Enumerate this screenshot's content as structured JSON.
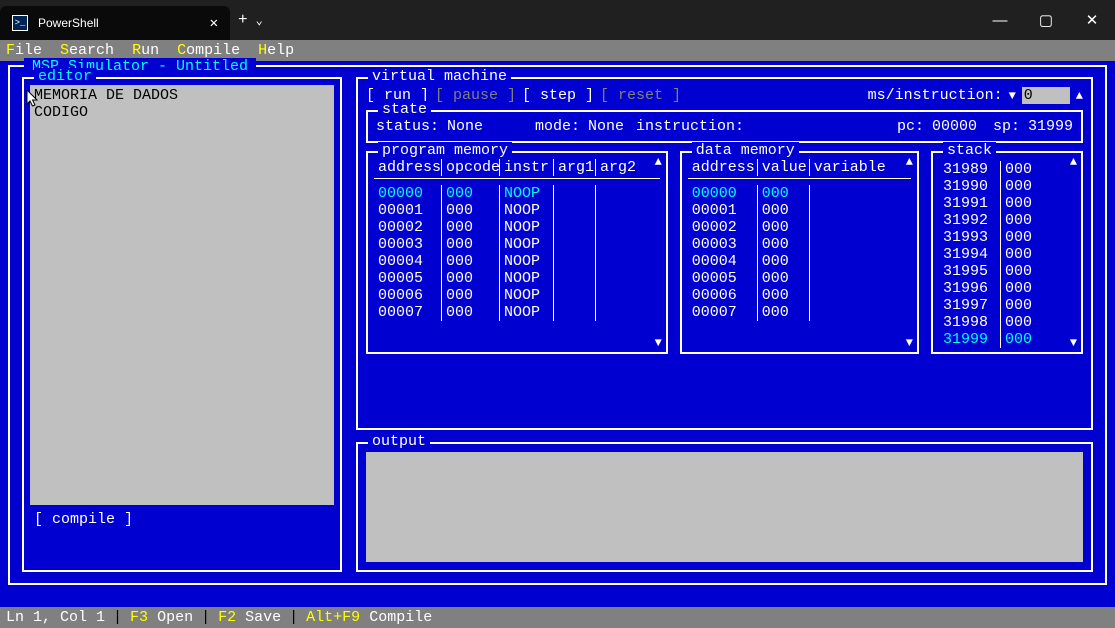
{
  "window": {
    "tab_title": "PowerShell"
  },
  "menus": {
    "file": "File",
    "search": "Search",
    "run": "Run",
    "compile": "Compile",
    "help": "Help"
  },
  "app_title": "MSP Simulator - Untitled",
  "editor": {
    "title": "editor",
    "content": "MEMORIA DE DADOS\nCODIGO",
    "compile_btn": "[ compile ]"
  },
  "vm": {
    "title": "virtual machine",
    "run": "[ run ]",
    "pause": "[ pause ]",
    "step": "[ step ]",
    "reset": "[ reset ]",
    "speed_label": "ms/instruction:",
    "speed_value": "0"
  },
  "state": {
    "title": "state",
    "status_label": "status:",
    "status_value": "None",
    "mode_label": "mode:",
    "mode_value": "None",
    "instr_label": "instruction:",
    "pc_label": "pc:",
    "pc_value": "00000",
    "sp_label": "sp:",
    "sp_value": "31999"
  },
  "pm": {
    "title": "program memory",
    "h_addr": "address",
    "h_op": "opcode",
    "h_in": "instr",
    "h_a1": "arg1",
    "h_a2": "arg2",
    "rows": [
      {
        "addr": "00000",
        "op": "000",
        "in": "NOOP",
        "hl": true
      },
      {
        "addr": "00001",
        "op": "000",
        "in": "NOOP"
      },
      {
        "addr": "00002",
        "op": "000",
        "in": "NOOP"
      },
      {
        "addr": "00003",
        "op": "000",
        "in": "NOOP"
      },
      {
        "addr": "00004",
        "op": "000",
        "in": "NOOP"
      },
      {
        "addr": "00005",
        "op": "000",
        "in": "NOOP"
      },
      {
        "addr": "00006",
        "op": "000",
        "in": "NOOP"
      },
      {
        "addr": "00007",
        "op": "000",
        "in": "NOOP"
      }
    ]
  },
  "dm": {
    "title": "data memory",
    "h_addr": "address",
    "h_val": "value",
    "h_var": "variable",
    "rows": [
      {
        "addr": "00000",
        "val": "000",
        "hl": true
      },
      {
        "addr": "00001",
        "val": "000"
      },
      {
        "addr": "00002",
        "val": "000"
      },
      {
        "addr": "00003",
        "val": "000"
      },
      {
        "addr": "00004",
        "val": "000"
      },
      {
        "addr": "00005",
        "val": "000"
      },
      {
        "addr": "00006",
        "val": "000"
      },
      {
        "addr": "00007",
        "val": "000"
      }
    ]
  },
  "stack": {
    "title": "stack",
    "rows": [
      {
        "addr": "31989",
        "val": "000"
      },
      {
        "addr": "31990",
        "val": "000"
      },
      {
        "addr": "31991",
        "val": "000"
      },
      {
        "addr": "31992",
        "val": "000"
      },
      {
        "addr": "31993",
        "val": "000"
      },
      {
        "addr": "31994",
        "val": "000"
      },
      {
        "addr": "31995",
        "val": "000"
      },
      {
        "addr": "31996",
        "val": "000"
      },
      {
        "addr": "31997",
        "val": "000"
      },
      {
        "addr": "31998",
        "val": "000"
      },
      {
        "addr": "31999",
        "val": "000",
        "hl": true
      }
    ]
  },
  "output": {
    "title": "output"
  },
  "statusbar": {
    "pos": "Ln 1, Col 1",
    "f3": "F3",
    "open": "Open",
    "f2": "F2",
    "save": "Save",
    "altf9": "Alt+F9",
    "compile": "Compile"
  }
}
